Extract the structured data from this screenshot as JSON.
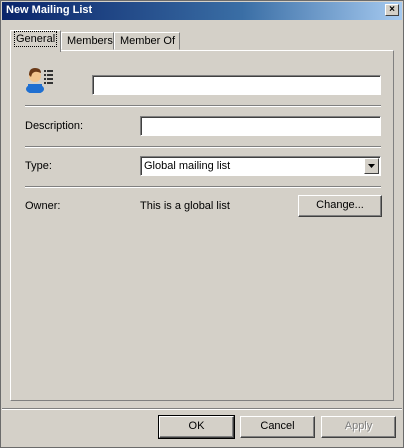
{
  "window": {
    "title": "New Mailing List",
    "close_glyph": "×"
  },
  "tabs": [
    {
      "label": "General",
      "active": true
    },
    {
      "label": "Members",
      "active": false
    },
    {
      "label": "Member Of",
      "active": false
    }
  ],
  "general": {
    "name_value": "",
    "description": {
      "label": "Description:",
      "value": ""
    },
    "type": {
      "label": "Type:",
      "selected": "Global mailing list"
    },
    "owner": {
      "label": "Owner:",
      "value": "This is a global list",
      "change_button": "Change..."
    }
  },
  "footer": {
    "ok": "OK",
    "cancel": "Cancel",
    "apply": "Apply"
  },
  "icons": {
    "user_list": "user-list-icon",
    "dropdown": "triangle-down"
  },
  "colors": {
    "face": "#d4d0c8",
    "titlebar_start": "#0a246a",
    "titlebar_end": "#a6caf0"
  }
}
